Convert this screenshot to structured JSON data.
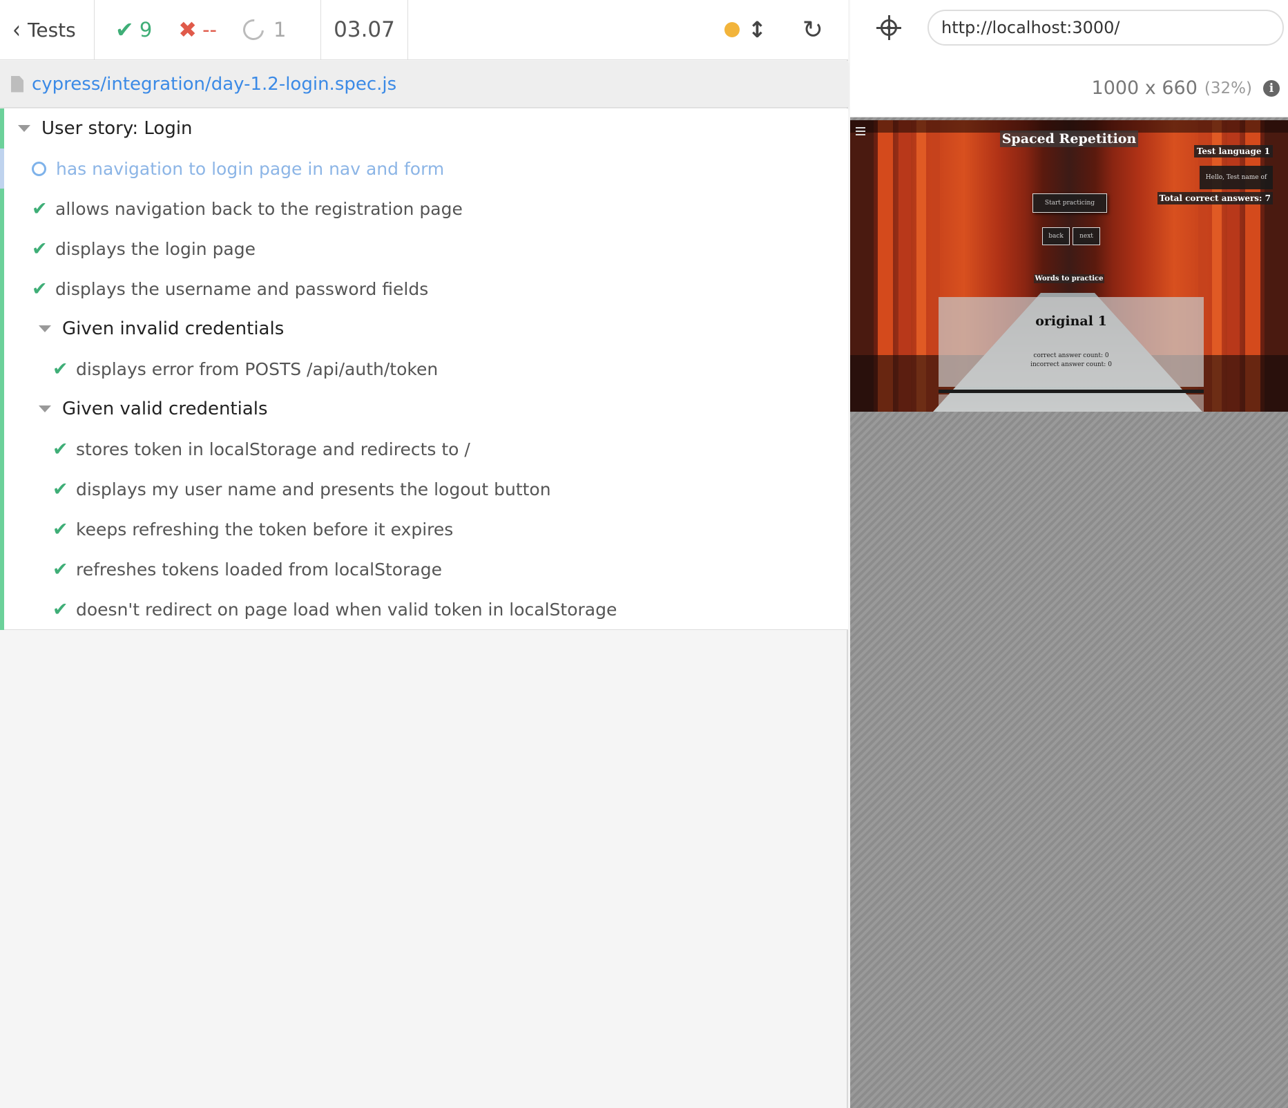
{
  "reporter": {
    "back_label": "Tests",
    "stats": {
      "passed": "9",
      "failed": "--",
      "pending": "1"
    },
    "duration": "03.07",
    "spec_path": "cypress/integration/day-1.2-login.spec.js"
  },
  "runnables": {
    "suite_login": "User story: Login",
    "tests": [
      "has navigation to login page in nav and form",
      "allows navigation back to the registration page",
      "displays the login page",
      "displays the username and password fields"
    ],
    "suite_invalid": "Given invalid credentials",
    "invalid_tests": [
      "displays error from POSTS /api/auth/token"
    ],
    "suite_valid": "Given valid credentials",
    "valid_tests": [
      "stores token in localStorage and redirects to /",
      "displays my user name and presents the logout button",
      "keeps refreshing the token before it expires",
      "refreshes tokens loaded from localStorage",
      "doesn't redirect on page load when valid token in localStorage"
    ]
  },
  "aut": {
    "url": "http://localhost:3000/",
    "viewport": "1000 x 660",
    "scale": "(32%)",
    "app": {
      "title": "Spaced Repetition",
      "language": "Test language 1",
      "hello": "Hello, Test name of",
      "total_correct": "Total correct answers: 7",
      "start_button": "Start practicing",
      "back_button": "back",
      "next_button": "next",
      "words_heading": "Words to practice",
      "word_original": "original 1",
      "correct_count": "correct answer count: 0",
      "incorrect_count": "incorrect answer count: 0"
    }
  },
  "colors": {
    "passed": "#3fae77",
    "failed": "#e05a4a",
    "pending": "#a8a8a8",
    "link": "#3b8ae6",
    "running": "#f2b43b"
  }
}
